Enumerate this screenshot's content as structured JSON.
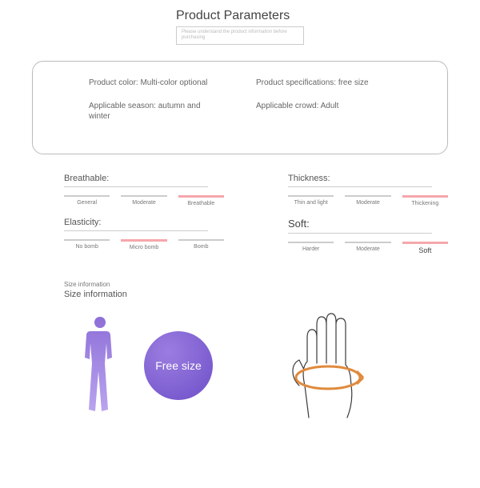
{
  "header": {
    "title": "Product Parameters",
    "note": "Please understand the product information before purchasing"
  },
  "params": {
    "color": "Product color: Multi-color optional",
    "spec": "Product specifications: free size",
    "season": "Applicable season: autumn and winter",
    "crowd": "Applicable crowd: Adult"
  },
  "scales": {
    "breathable": {
      "title": "Breathable:",
      "opts": [
        "General",
        "Moderate",
        "Breathable"
      ],
      "active": 2
    },
    "elasticity": {
      "title": "Elasticity:",
      "opts": [
        "No bomb",
        "Micro bomb",
        "Bomb"
      ],
      "active": 1
    },
    "thickness": {
      "title": "Thickness:",
      "opts": [
        "Thin and light",
        "Moderate",
        "Thickening"
      ],
      "active": 2
    },
    "soft": {
      "title": "Soft:",
      "opts": [
        "Harder",
        "Moderate",
        "Soft"
      ],
      "active": 2
    }
  },
  "size": {
    "small": "Size information",
    "heading": "Size information",
    "badge": "Free size"
  }
}
